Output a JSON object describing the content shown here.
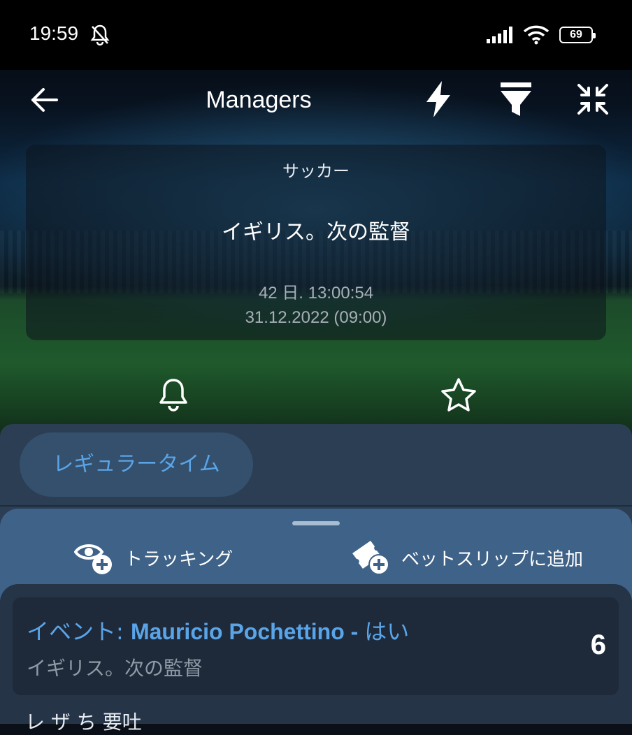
{
  "status_bar": {
    "time": "19:59",
    "battery": "69"
  },
  "toolbar": {
    "title": "Managers"
  },
  "event_card": {
    "sport": "サッカー",
    "name": "イギリス。次の監督",
    "countdown": "42 日. 13:00:54",
    "datetime": "31.12.2022 (09:00)"
  },
  "market_tab": {
    "label": "レギュラータイム"
  },
  "actions": {
    "tracking": "トラッキング",
    "add_to_slip": "ベットスリップに追加"
  },
  "bet": {
    "event_prefix": "イベント: ",
    "selection": "Mauricio Pochettino - ",
    "outcome": "はい",
    "market": "イギリス。次の監督",
    "odds": "6"
  },
  "partial_text": "レ ザ ち 要吐",
  "colors": {
    "accent": "#5aa4e8",
    "sheet": "#3f6288",
    "panel": "#2b3e54"
  }
}
